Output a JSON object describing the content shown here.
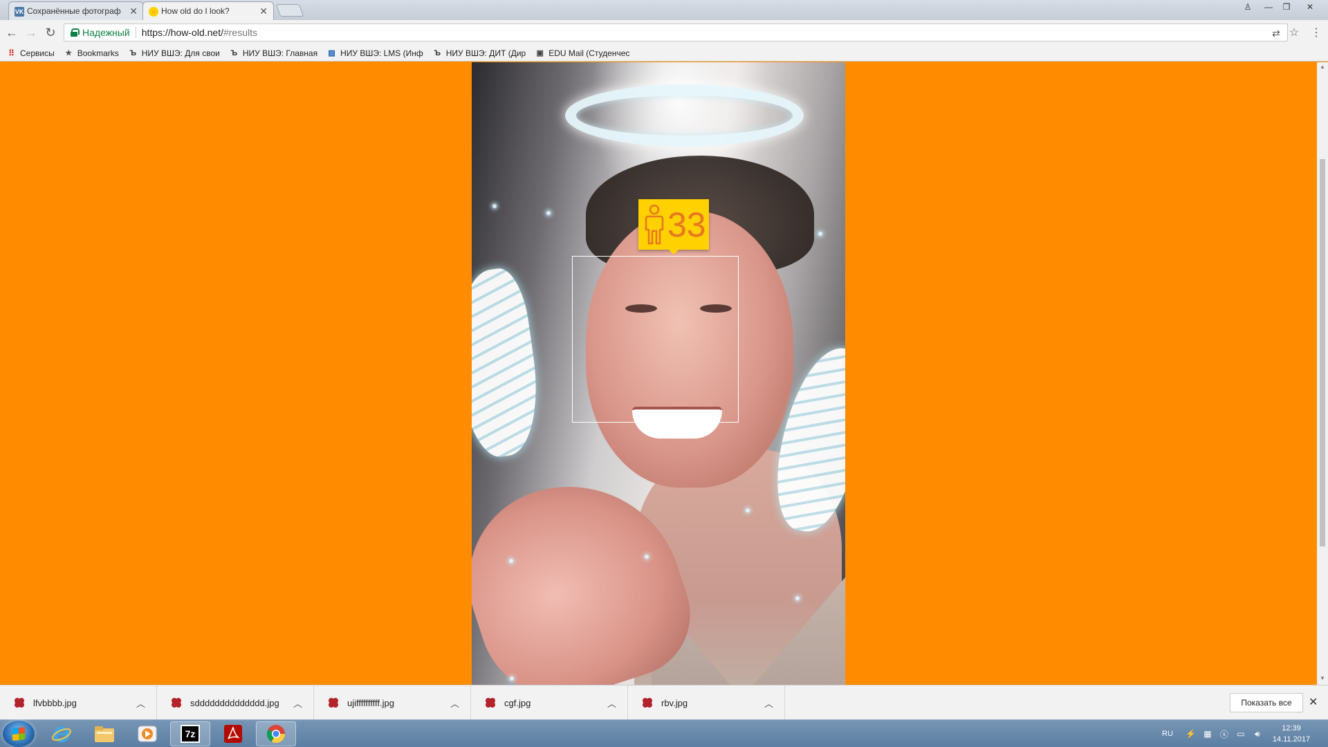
{
  "tabs": [
    {
      "title": "Сохранённые фотограф",
      "favicon": "vk-icon",
      "active": false
    },
    {
      "title": "How old do I look?",
      "favicon": "how-old-icon",
      "active": true
    }
  ],
  "omnibox": {
    "secure_label": "Надежный",
    "url_host": "https://how-old.net/",
    "url_path": "#results"
  },
  "bookmarks": [
    {
      "label": "Сервисы",
      "icon": "apps-grid-icon"
    },
    {
      "label": "Bookmarks",
      "icon": "star-icon"
    },
    {
      "label": "НИУ ВШЭ: Для свои",
      "icon": "hse-icon"
    },
    {
      "label": "НИУ ВШЭ: Главная",
      "icon": "hse-icon"
    },
    {
      "label": "НИУ ВШЭ: LMS (Инф",
      "icon": "lms-icon"
    },
    {
      "label": "НИУ ВШЭ: ДИТ (Дир",
      "icon": "hse-icon"
    },
    {
      "label": "EDU Mail (Студенчес",
      "icon": "edu-mail-icon"
    }
  ],
  "result": {
    "age": "33",
    "gender_icon": "male-person-icon",
    "badge_color": "#ffd100",
    "age_color": "#e87722"
  },
  "page_background": "#ff8c00",
  "downloads": {
    "items": [
      {
        "name": "lfvbbbb.jpg"
      },
      {
        "name": "sdddddddddddddd.jpg"
      },
      {
        "name": "ujiffffffffff.jpg"
      },
      {
        "name": "cgf.jpg"
      },
      {
        "name": "rbv.jpg"
      }
    ],
    "show_all_label": "Показать все"
  },
  "taskbar": {
    "apps": [
      "internet-explorer-icon",
      "file-explorer-icon",
      "media-player-icon",
      "7zip-icon",
      "acrobat-icon",
      "chrome-icon"
    ],
    "language": "RU",
    "time": "12:39",
    "date": "14.11.2017"
  }
}
